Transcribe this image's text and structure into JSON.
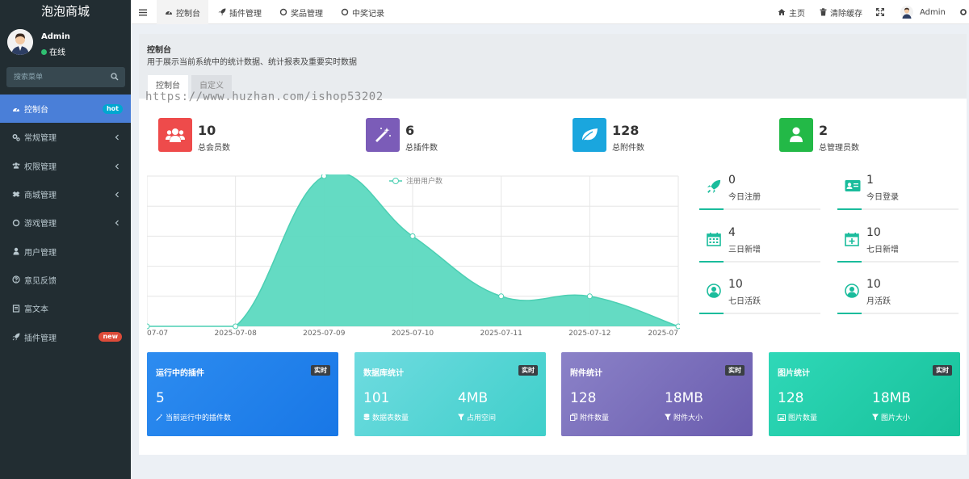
{
  "sidebar": {
    "logo": "泡泡商城",
    "user": {
      "name": "Admin",
      "status": "在线"
    },
    "search_placeholder": "搜索菜单",
    "items": [
      {
        "label": "控制台",
        "badge": "hot"
      },
      {
        "label": "常规管理"
      },
      {
        "label": "权限管理"
      },
      {
        "label": "商城管理"
      },
      {
        "label": "游戏管理"
      },
      {
        "label": "用户管理"
      },
      {
        "label": "意见反馈"
      },
      {
        "label": "富文本"
      },
      {
        "label": "插件管理",
        "badge": "new"
      }
    ]
  },
  "topbar": {
    "tabs": [
      "控制台",
      "插件管理",
      "奖品管理",
      "中奖记录"
    ],
    "home": "主页",
    "clear_cache": "清除缓存",
    "admin": "Admin"
  },
  "panel": {
    "title": "控制台",
    "subtitle": "用于展示当前系统中的统计数据、统计报表及重要实时数据",
    "tabs": [
      "控制台",
      "自定义"
    ]
  },
  "stats": [
    {
      "value": "10",
      "label": "总会员数",
      "color": "#ee4b4b"
    },
    {
      "value": "6",
      "label": "总插件数",
      "color": "#7b5cb8"
    },
    {
      "value": "128",
      "label": "总附件数",
      "color": "#1aa6de"
    },
    {
      "value": "2",
      "label": "总管理员数",
      "color": "#23b947"
    }
  ],
  "chart_data": {
    "type": "area",
    "x": [
      "07-07",
      "2025-07-08",
      "2025-07-09",
      "2025-07-10",
      "2025-07-11",
      "2025-07-12",
      "2025-07"
    ],
    "series": [
      {
        "name": "注册用户数",
        "values": [
          0,
          0,
          5,
          3,
          1,
          1,
          0
        ]
      }
    ],
    "ylim": [
      0,
      5
    ],
    "grid": true,
    "legend": "top-center",
    "color": "#5cd9c0"
  },
  "mini_stats": [
    {
      "value": "0",
      "label": "今日注册"
    },
    {
      "value": "1",
      "label": "今日登录"
    },
    {
      "value": "4",
      "label": "三日新增"
    },
    {
      "value": "10",
      "label": "七日新增"
    },
    {
      "value": "10",
      "label": "七日活跃"
    },
    {
      "value": "10",
      "label": "月活跃"
    }
  ],
  "cards": [
    {
      "title": "运行中的插件",
      "tag": "实时",
      "v1": "5",
      "l1": "当前运行中的插件数"
    },
    {
      "title": "数据库统计",
      "tag": "实时",
      "v1": "101",
      "l1": "数据表数量",
      "v2": "4MB",
      "l2": "占用空间"
    },
    {
      "title": "附件统计",
      "tag": "实时",
      "v1": "128",
      "l1": "附件数量",
      "v2": "18MB",
      "l2": "附件大小"
    },
    {
      "title": "图片统计",
      "tag": "实时",
      "v1": "128",
      "l1": "图片数量",
      "v2": "18MB",
      "l2": "图片大小"
    }
  ],
  "watermark": "https://www.huzhan.com/ishop53202"
}
